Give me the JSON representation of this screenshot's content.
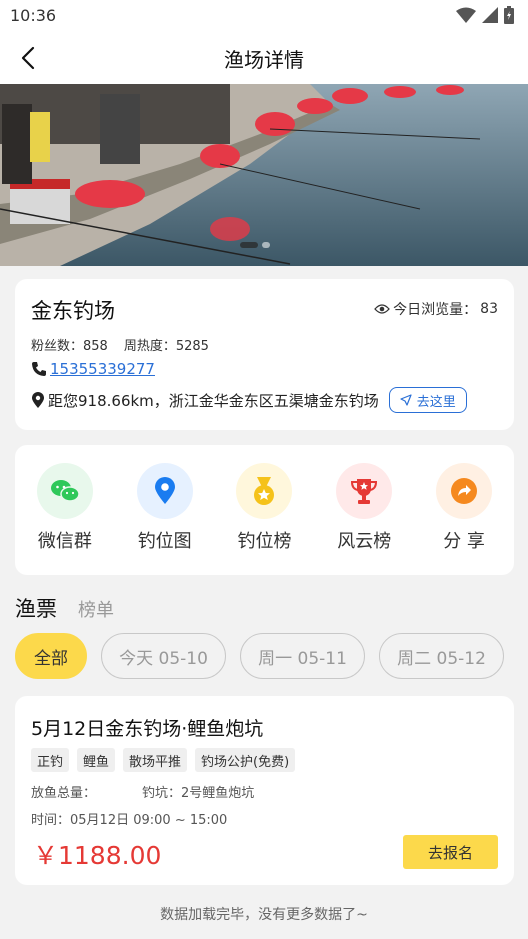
{
  "status_bar": {
    "time": "10:36"
  },
  "nav": {
    "title": "渔场详情"
  },
  "shop": {
    "name": "金东钓场",
    "views_label": "今日浏览量：",
    "views_value": "83",
    "fans": "粉丝数：858",
    "heat": "周热度：5285",
    "phone": "15355339277",
    "address": "距您918.66km，浙江金华金东区五渠塘金东钓场",
    "go_label": "去这里"
  },
  "actions": [
    {
      "label": "微信群",
      "icon": "wechat-icon",
      "bg": "#e8f8ec",
      "color": "#2fc85a"
    },
    {
      "label": "钓位图",
      "icon": "location-pin-icon",
      "bg": "#e6f1ff",
      "color": "#1a7cf0"
    },
    {
      "label": "钓位榜",
      "icon": "medal-icon",
      "bg": "#fff7dc",
      "color": "#f5c21a"
    },
    {
      "label": "风云榜",
      "icon": "trophy-icon",
      "bg": "#ffe9e9",
      "color": "#e53935"
    },
    {
      "label": "分 享",
      "icon": "share-icon",
      "bg": "#fff0e3",
      "color": "#f5891f"
    }
  ],
  "tabs": {
    "active": "渔票",
    "inactive": "榜单"
  },
  "dates": [
    "全部",
    "今天 05-10",
    "周一 05-11",
    "周二 05-12"
  ],
  "ticket": {
    "title": "5月12日金东钓场·鲤鱼炮坑",
    "tags": [
      "正钓",
      "鲤鱼",
      "散场平推",
      "钓场公护(免费)"
    ],
    "total_fish": "放鱼总量：",
    "pit": "钓坑：2号鲤鱼炮坑",
    "time": "时间：05月12日 09:00 ~ 15:00",
    "price": "￥1188.00",
    "signup": "去报名"
  },
  "footer": "数据加载完毕，没有更多数据了~",
  "colors": {
    "accent_yellow": "#fcd94b",
    "price_red": "#e53935",
    "link_blue": "#2a6fd6"
  }
}
